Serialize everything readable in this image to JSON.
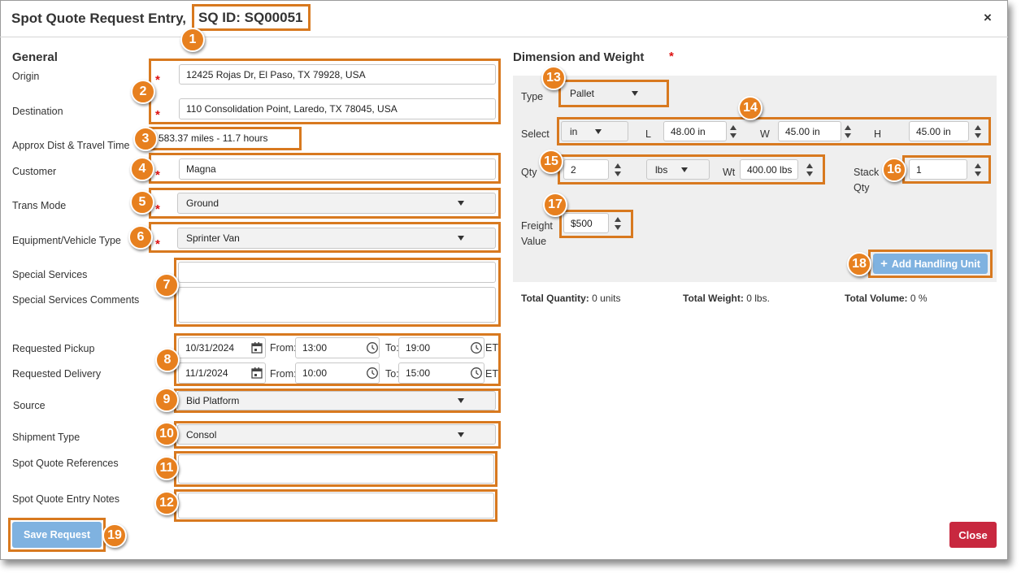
{
  "header": {
    "title": "Spot Quote Request Entry,",
    "sq_id": "SQ ID: SQ00051",
    "close": "×"
  },
  "general": {
    "heading": "General",
    "origin": {
      "label": "Origin",
      "value": "12425 Rojas Dr, El Paso, TX 79928, USA"
    },
    "destination": {
      "label": "Destination",
      "value": "110 Consolidation Point, Laredo, TX 78045, USA"
    },
    "approx": {
      "label": "Approx Dist & Travel Time",
      "value": "583.37 miles - 11.7 hours"
    },
    "customer": {
      "label": "Customer",
      "value": "Magna"
    },
    "trans_mode": {
      "label": "Trans Mode",
      "value": "Ground"
    },
    "equipment": {
      "label": "Equipment/Vehicle Type",
      "value": "Sprinter Van"
    },
    "special_services": {
      "label": "Special Services",
      "value": ""
    },
    "special_comments": {
      "label": "Special Services Comments",
      "value": ""
    },
    "pickup": {
      "label": "Requested Pickup",
      "date": "10/31/2024",
      "from_label": "From:",
      "from": "13:00",
      "to_label": "To:",
      "to": "19:00",
      "tz": "ET"
    },
    "delivery": {
      "label": "Requested Delivery",
      "date": "11/1/2024",
      "from_label": "From:",
      "from": "10:00",
      "to_label": "To:",
      "to": "15:00",
      "tz": "ET"
    },
    "source": {
      "label": "Source",
      "value": "Bid Platform"
    },
    "shipment_type": {
      "label": "Shipment Type",
      "value": "Consol"
    },
    "references": {
      "label": "Spot Quote References",
      "value": ""
    },
    "notes": {
      "label": "Spot Quote Entry Notes",
      "value": ""
    },
    "required_mark": "*"
  },
  "dims": {
    "heading": "Dimension and Weight",
    "required_mark": "*",
    "type": {
      "label": "Type",
      "value": "Pallet"
    },
    "select": {
      "label": "Select",
      "unit": "in",
      "l_label": "L",
      "l": "48.00 in",
      "w_label": "W",
      "w": "45.00 in",
      "h_label": "H",
      "h": "45.00 in"
    },
    "qty": {
      "label": "Qty",
      "value": "2",
      "wunit": "lbs",
      "wt_label": "Wt",
      "wt": "400.00 lbs"
    },
    "stack": {
      "label_1": "Stack",
      "label_2": "Qty",
      "value": "1"
    },
    "freight": {
      "label_1": "Freight",
      "label_2": "Value",
      "value": "$500"
    },
    "add_button": "Add Handling Unit",
    "add_icon": "+",
    "totals": {
      "qty_label": "Total Quantity:",
      "qty": "0 units",
      "weight_label": "Total Weight:",
      "weight": "0 lbs.",
      "volume_label": "Total Volume:",
      "volume": "0 %"
    }
  },
  "footer": {
    "save": "Save Request",
    "close": "Close"
  },
  "badges": [
    "1",
    "2",
    "3",
    "4",
    "5",
    "6",
    "7",
    "8",
    "9",
    "10",
    "11",
    "12",
    "13",
    "14",
    "15",
    "16",
    "17",
    "18",
    "19"
  ],
  "colors": {
    "accent_orange": "#d8791f",
    "badge_orange": "#e7801f",
    "save_blue": "#7fb2e0",
    "close_red": "#c8283f",
    "required_red": "#dd1111"
  },
  "icons": {
    "calendar": "calendar-icon",
    "clock": "clock-icon",
    "spinner": "spinner-icon",
    "dropdown": "chevron-down-icon"
  }
}
